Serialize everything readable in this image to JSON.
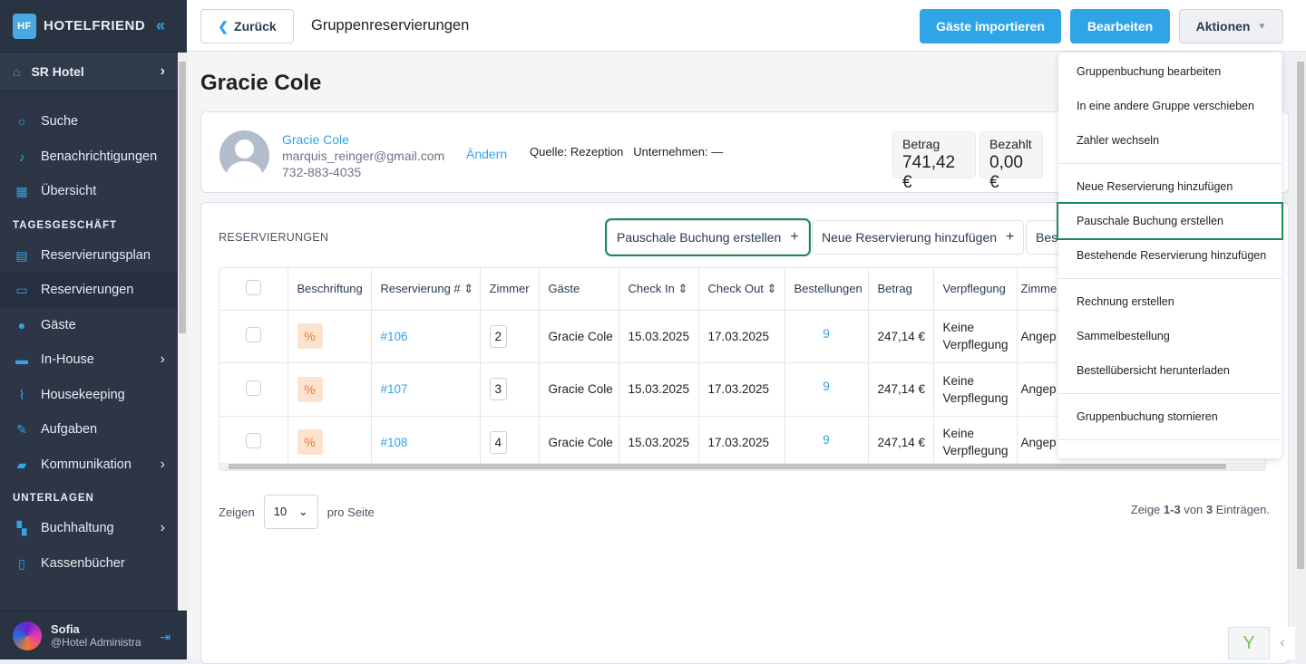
{
  "sidebar": {
    "brand": "HOTELFRIEND",
    "hotel": "SR Hotel",
    "items": [
      {
        "label": "Suche",
        "icon": "search-icon"
      },
      {
        "label": "Benachrichtigungen",
        "icon": "bell-icon"
      },
      {
        "label": "Übersicht",
        "icon": "dashboard-icon"
      }
    ],
    "section1": "TAGESGESCHÄFT",
    "items2": [
      {
        "label": "Reservierungsplan",
        "icon": "calendar-icon"
      },
      {
        "label": "Reservierungen",
        "icon": "document-icon",
        "active": true
      },
      {
        "label": "Gäste",
        "icon": "user-icon"
      },
      {
        "label": "In-House",
        "icon": "bed-icon"
      },
      {
        "label": "Housekeeping",
        "icon": "broom-icon"
      },
      {
        "label": "Aufgaben",
        "icon": "wrench-icon"
      },
      {
        "label": "Kommunikation",
        "icon": "chat-icon"
      }
    ],
    "section2": "UNTERLAGEN",
    "items3": [
      {
        "label": "Buchhaltung",
        "icon": "accounting-icon"
      },
      {
        "label": "Kassenbücher",
        "icon": "cashbook-icon"
      }
    ],
    "user": {
      "name": "Sofia",
      "role": "@Hotel Administrator"
    }
  },
  "header": {
    "back": "Zurück",
    "title": "Gruppenreservierungen",
    "import": "Gäste importieren",
    "edit": "Bearbeiten",
    "actions": "Aktionen"
  },
  "guest": {
    "heading": "Gracie Cole",
    "name": "Gracie Cole",
    "email": "marquis_reinger@gmail.com",
    "phone": "732-883-4035",
    "change": "Ändern",
    "source_label": "Quelle:",
    "source": "Rezeption",
    "company_label": "Unternehmen:",
    "company": "—",
    "amount_label": "Betrag",
    "amount": "741,42 €",
    "paid_label": "Bezahlt",
    "paid": "0,00 €"
  },
  "reservations": {
    "title": "RESERVIERUNGEN",
    "btn_package": "Pauschale Buchung erstellen",
    "btn_new": "Neue Reservierung hinzufügen",
    "btn_existing": "Bes",
    "columns": [
      "Beschriftung",
      "Reservierung #",
      "Zimmer",
      "Gäste",
      "Check In",
      "Check Out",
      "Bestellungen",
      "Betrag",
      "Verpflegung",
      "Zimme"
    ],
    "rows": [
      {
        "id": "#106",
        "room": "2",
        "guest": "Gracie Cole",
        "in": "15.03.2025",
        "out": "17.03.2025",
        "orders": "9",
        "amount": "247,14 €",
        "meal1": "Keine",
        "meal2": "Verpflegung",
        "type": "Angep"
      },
      {
        "id": "#107",
        "room": "3",
        "guest": "Gracie Cole",
        "in": "15.03.2025",
        "out": "17.03.2025",
        "orders": "9",
        "amount": "247,14 €",
        "meal1": "Keine",
        "meal2": "Verpflegung",
        "type": "Angep"
      },
      {
        "id": "#108",
        "room": "4",
        "guest": "Gracie Cole",
        "in": "15.03.2025",
        "out": "17.03.2025",
        "orders": "9",
        "amount": "247,14 €",
        "meal1": "Keine",
        "meal2": "Verpflegung",
        "type": "Angep"
      }
    ],
    "show": "Zeigen",
    "per_page": "10",
    "per_page_label": "pro Seite",
    "summary_pre": "Zeige ",
    "summary_range": "1-3",
    "summary_mid": " von ",
    "summary_total": "3",
    "summary_post": " Einträgen."
  },
  "menu": {
    "items": [
      "Gruppenbuchung bearbeiten",
      "In eine andere Gruppe verschieben",
      "Zahler wechseln",
      "Neue Reservierung hinzufügen",
      "Pauschale Buchung erstellen",
      "Bestehende Reservierung hinzufügen",
      "Rechnung erstellen",
      "Sammelbestellung",
      "Bestellübersicht herunterladen",
      "Gruppenbuchung stornieren"
    ]
  },
  "colors": {
    "accent": "#2fa4e7",
    "sidebar": "#2c3646",
    "highlight": "#1d8a5a"
  }
}
